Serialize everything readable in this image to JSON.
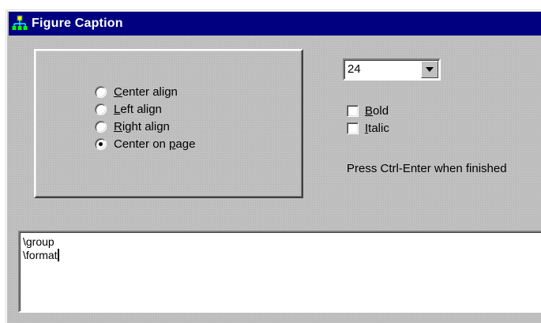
{
  "window": {
    "title": "Figure Caption",
    "icon": "hierarchy-app-icon"
  },
  "alignment": {
    "options": [
      {
        "label_underlined": "C",
        "label_rest": "enter align",
        "selected": false
      },
      {
        "label_underlined": "L",
        "label_rest": "eft align",
        "selected": false
      },
      {
        "label_underlined": "R",
        "label_rest": "ight align",
        "selected": false
      },
      {
        "label_before": "Center on ",
        "label_underlined": "p",
        "label_rest": "age",
        "selected": true
      }
    ]
  },
  "font_size": {
    "value": "24"
  },
  "style": {
    "bold": {
      "label_underlined": "B",
      "label_rest": "old",
      "checked": false
    },
    "italic": {
      "label_underlined": "I",
      "label_rest": "talic",
      "checked": false
    }
  },
  "hint": "Press Ctrl-Enter when finished",
  "editor": {
    "lines": [
      "\\group",
      "\\format"
    ]
  },
  "colors": {
    "titlebar": "#000080",
    "face": "#c0c0c0"
  }
}
